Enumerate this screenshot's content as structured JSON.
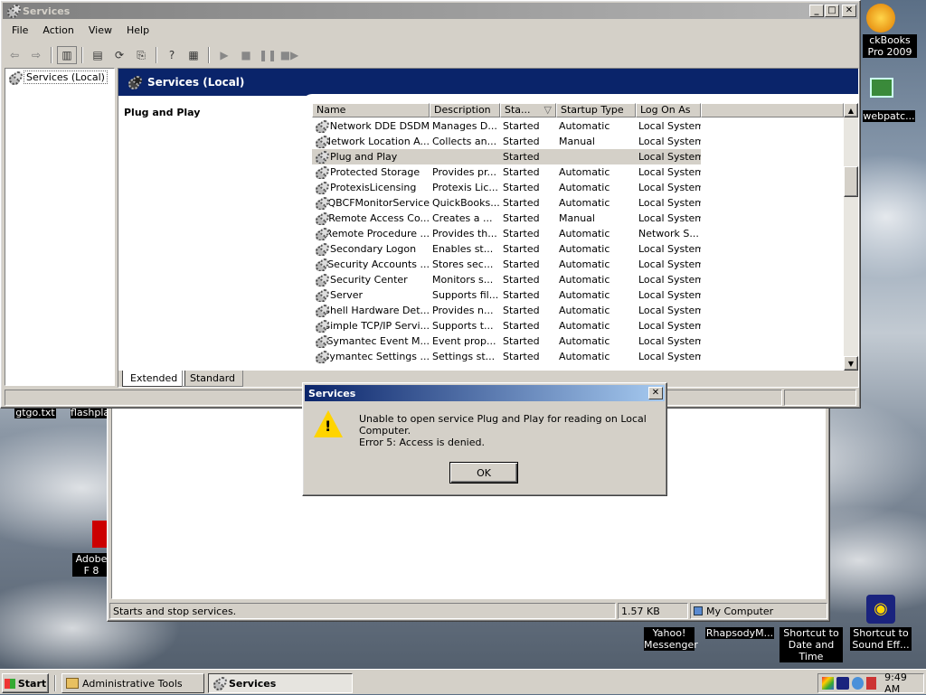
{
  "desktop": {
    "icons": [
      {
        "label": "ckBooks Pro 2009"
      },
      {
        "label": "webpatc..."
      },
      {
        "label": "gtgo.txt"
      },
      {
        "label": "flashpla"
      },
      {
        "label": "Adobe F 8"
      },
      {
        "label": "Shortcut to Sound Eff..."
      },
      {
        "label": "Yahoo! Messenger"
      },
      {
        "label": "RhapsodyM..."
      },
      {
        "label": "Shortcut to Date and Time"
      }
    ]
  },
  "back_window": {
    "status": "Starts and stop services.",
    "size": "1.57 KB",
    "location": "My Computer"
  },
  "services_window": {
    "title": "Services",
    "menu": [
      "File",
      "Action",
      "View",
      "Help"
    ],
    "tree_item": "Services (Local)",
    "banner_title": "Services (Local)",
    "selected_name": "Plug and Play",
    "columns": [
      "Name",
      "Description",
      "Sta...",
      "Startup Type",
      "Log On As"
    ],
    "rows": [
      {
        "name": "Network DDE DSDM",
        "desc": "Manages D...",
        "status": "Started",
        "startup": "Automatic",
        "logon": "Local System"
      },
      {
        "name": "Network Location A...",
        "desc": "Collects an...",
        "status": "Started",
        "startup": "Manual",
        "logon": "Local System"
      },
      {
        "name": "Plug and Play",
        "desc": "",
        "status": "Started",
        "startup": "",
        "logon": "Local System"
      },
      {
        "name": "Protected Storage",
        "desc": "Provides pr...",
        "status": "Started",
        "startup": "Automatic",
        "logon": "Local System"
      },
      {
        "name": "ProtexisLicensing",
        "desc": "Protexis Lic...",
        "status": "Started",
        "startup": "Automatic",
        "logon": "Local System"
      },
      {
        "name": "QBCFMonitorService",
        "desc": "QuickBooks...",
        "status": "Started",
        "startup": "Automatic",
        "logon": "Local System"
      },
      {
        "name": "Remote Access Co...",
        "desc": "Creates a ...",
        "status": "Started",
        "startup": "Manual",
        "logon": "Local System"
      },
      {
        "name": "Remote Procedure ...",
        "desc": "Provides th...",
        "status": "Started",
        "startup": "Automatic",
        "logon": "Network S..."
      },
      {
        "name": "Secondary Logon",
        "desc": "Enables st...",
        "status": "Started",
        "startup": "Automatic",
        "logon": "Local System"
      },
      {
        "name": "Security Accounts ...",
        "desc": "Stores sec...",
        "status": "Started",
        "startup": "Automatic",
        "logon": "Local System"
      },
      {
        "name": "Security Center",
        "desc": "Monitors s...",
        "status": "Started",
        "startup": "Automatic",
        "logon": "Local System"
      },
      {
        "name": "Server",
        "desc": "Supports fil...",
        "status": "Started",
        "startup": "Automatic",
        "logon": "Local System"
      },
      {
        "name": "Shell Hardware Det...",
        "desc": "Provides n...",
        "status": "Started",
        "startup": "Automatic",
        "logon": "Local System"
      },
      {
        "name": "Simple TCP/IP Servi...",
        "desc": "Supports t...",
        "status": "Started",
        "startup": "Automatic",
        "logon": "Local System"
      },
      {
        "name": "Symantec Event M...",
        "desc": "Event prop...",
        "status": "Started",
        "startup": "Automatic",
        "logon": "Local System"
      },
      {
        "name": "Symantec Settings ...",
        "desc": "Settings st...",
        "status": "Started",
        "startup": "Automatic",
        "logon": "Local System"
      }
    ],
    "tabs": [
      "Extended",
      "Standard"
    ]
  },
  "dialog": {
    "title": "Services",
    "message": "Unable to open service Plug and Play for reading on Local Computer.",
    "error": "Error 5: Access is denied.",
    "ok_label": "OK"
  },
  "taskbar": {
    "start_label": "Start",
    "buttons": [
      "Administrative Tools",
      "Services"
    ],
    "clock": "9:49 AM"
  },
  "colors": {
    "active_title": "#0a246a",
    "selection": "#d4d0c8",
    "banner": "#0a246a"
  }
}
